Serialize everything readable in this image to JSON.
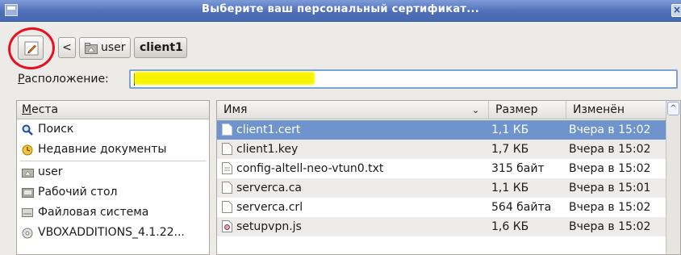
{
  "window": {
    "title": "Выберите ваш персональный сертификат...",
    "close_glyph": "×"
  },
  "toolbar": {
    "back_glyph": "<",
    "path": [
      "user",
      "client1"
    ]
  },
  "location": {
    "label_underlined": "Р",
    "label_rest": "асположение:",
    "value": "",
    "highlight_color": "#f8f400"
  },
  "places": {
    "header_underlined": "М",
    "header_rest": "еста",
    "items": [
      {
        "label": "Поиск",
        "icon": "search-icon"
      },
      {
        "label": "Недавние документы",
        "icon": "recent-icon"
      },
      {
        "label": "user",
        "icon": "home-folder-icon"
      },
      {
        "label": "Рабочий стол",
        "icon": "desktop-icon"
      },
      {
        "label": "Файловая система",
        "icon": "filesystem-icon"
      },
      {
        "label": "VBOXADDITIONS_4.1.22...",
        "icon": "cdrom-icon"
      }
    ]
  },
  "files": {
    "columns": {
      "name": "Имя",
      "size": "Размер",
      "modified": "Изменён"
    },
    "sort_glyph": "⌄",
    "rows": [
      {
        "name": "client1.cert",
        "size": "1,1 КБ",
        "modified": "Вчера в 15:02",
        "selected": true,
        "icon": "file-icon"
      },
      {
        "name": "client1.key",
        "size": "1,7 КБ",
        "modified": "Вчера в 15:02",
        "selected": false,
        "icon": "file-icon"
      },
      {
        "name": "config-altell-neo-vtun0.txt",
        "size": "315 байт",
        "modified": "Вчера в 15:02",
        "selected": false,
        "icon": "text-file-icon"
      },
      {
        "name": "serverca.ca",
        "size": "1,1 КБ",
        "modified": "Вчера в 15:01",
        "selected": false,
        "icon": "file-icon"
      },
      {
        "name": "serverca.crl",
        "size": "564 байта",
        "modified": "Вчера в 15:02",
        "selected": false,
        "icon": "file-icon"
      },
      {
        "name": "setupvpn.js",
        "size": "1,6 КБ",
        "modified": "Вчера в 15:02",
        "selected": false,
        "icon": "script-file-icon"
      }
    ]
  },
  "colors": {
    "selection": "#6e93cd",
    "titlebar": "#4f6fb8",
    "annotation_circle": "#e8101c"
  }
}
